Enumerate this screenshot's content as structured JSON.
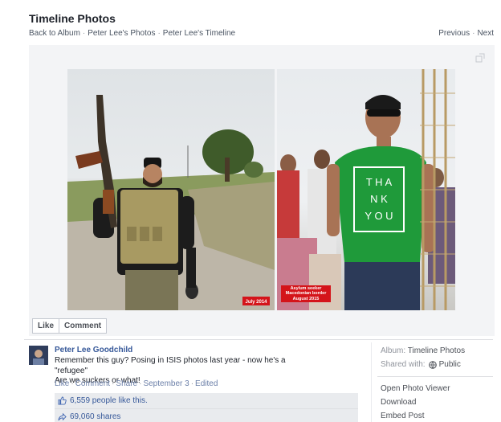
{
  "header": {
    "title": "Timeline Photos",
    "breadcrumbs": [
      "Back to Album",
      "Peter Lee's Photos",
      "Peter Lee's Timeline"
    ],
    "nav": [
      "Previous",
      "Next"
    ]
  },
  "photo": {
    "left_caption": "July 2014",
    "right_caption": "Asylum seeker Macedonian border August 2015",
    "right_caption_lines": [
      "Asylum seeker",
      "Macedonian border",
      "August 2015"
    ],
    "shirt_text": [
      "T H A",
      "N K",
      "Y O U"
    ]
  },
  "actions": {
    "like": "Like",
    "comment": "Comment"
  },
  "post": {
    "author": "Peter Lee Goodchild",
    "caption_line1": "Remember this guy? Posing in ISIS photos last year - now he's a \"refugee\"",
    "caption_line2": "Are we suckers or what!",
    "meta": [
      "Like",
      "Comment",
      "Share",
      "September 3",
      "Edited"
    ],
    "likes": "6,559 people like this.",
    "shares": "69,060 shares"
  },
  "sidebar": {
    "album_label": "Album:",
    "album_value": "Timeline Photos",
    "shared_label": "Shared with:",
    "shared_value": "Public",
    "links": [
      "Open Photo Viewer",
      "Download",
      "Embed Post"
    ]
  },
  "colors": {
    "link": "#365899",
    "tag_red": "#d4141a",
    "shirt_green": "#1f9a3a"
  }
}
